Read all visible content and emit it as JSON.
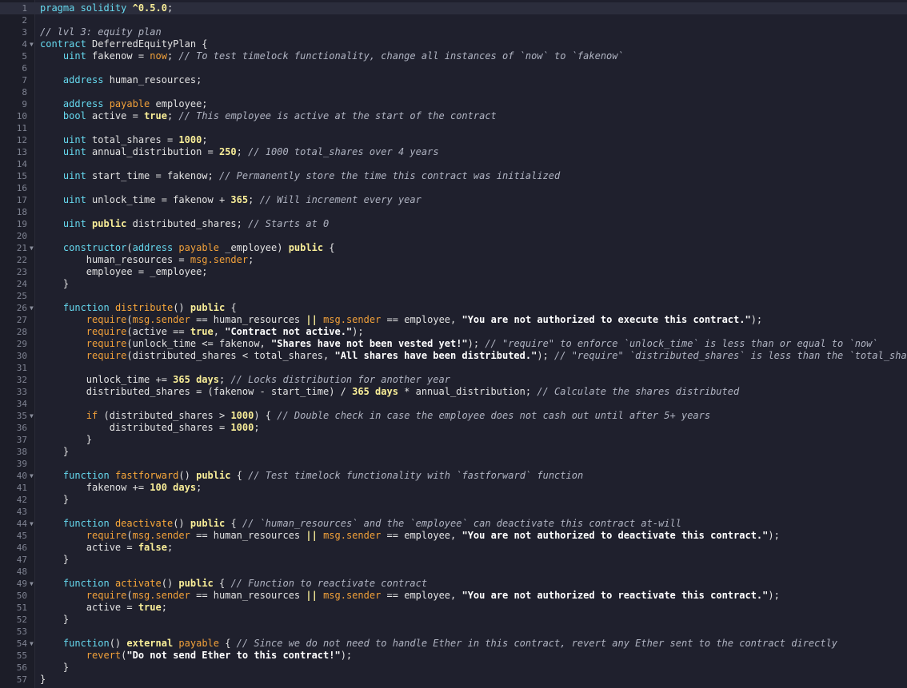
{
  "editor": {
    "language": "solidity",
    "theme_colors": {
      "background": "#1f202d",
      "gutter": "#1c1d28",
      "active_line": "#2b2d3c",
      "keyword": "#66d9ef",
      "special": "#f2a13a",
      "literal": "#f9ee98",
      "comment": "#b0b4c2",
      "string": "#ffffff",
      "text": "#e3e3e3"
    },
    "active_line": 1,
    "fold_lines": [
      4,
      21,
      26,
      35,
      40,
      44,
      49,
      54
    ],
    "lines": [
      [
        [
          "kw",
          "pragma solidity "
        ],
        [
          "lit",
          "^0.5.0"
        ],
        [
          "",
          "; "
        ]
      ],
      [],
      [
        [
          "cm",
          "// lvl 3: equity plan"
        ]
      ],
      [
        [
          "kw",
          "contract "
        ],
        [
          "",
          "DeferredEquityPlan {"
        ]
      ],
      [
        [
          "",
          "    "
        ],
        [
          "kw",
          "uint "
        ],
        [
          "",
          "fakenow = "
        ],
        [
          "sp",
          "now"
        ],
        [
          "",
          "; "
        ],
        [
          "cm",
          "// To test timelock functionality, change all instances of `now` to `fakenow`"
        ]
      ],
      [],
      [
        [
          "",
          "    "
        ],
        [
          "kw",
          "address "
        ],
        [
          "",
          "human_resources;"
        ]
      ],
      [],
      [
        [
          "",
          "    "
        ],
        [
          "kw",
          "address "
        ],
        [
          "sp",
          "payable "
        ],
        [
          "",
          "employee;"
        ]
      ],
      [
        [
          "",
          "    "
        ],
        [
          "kw",
          "bool "
        ],
        [
          "",
          "active = "
        ],
        [
          "lit",
          "true"
        ],
        [
          "",
          "; "
        ],
        [
          "cm",
          "// This employee is active at the start of the contract"
        ]
      ],
      [],
      [
        [
          "",
          "    "
        ],
        [
          "kw",
          "uint "
        ],
        [
          "",
          "total_shares = "
        ],
        [
          "lit",
          "1000"
        ],
        [
          "",
          ";"
        ]
      ],
      [
        [
          "",
          "    "
        ],
        [
          "kw",
          "uint "
        ],
        [
          "",
          "annual_distribution = "
        ],
        [
          "lit",
          "250"
        ],
        [
          "",
          "; "
        ],
        [
          "cm",
          "// 1000 total_shares over 4 years"
        ]
      ],
      [],
      [
        [
          "",
          "    "
        ],
        [
          "kw",
          "uint "
        ],
        [
          "",
          "start_time = fakenow; "
        ],
        [
          "cm",
          "// Permanently store the time this contract was initialized"
        ]
      ],
      [],
      [
        [
          "",
          "    "
        ],
        [
          "kw",
          "uint "
        ],
        [
          "",
          "unlock_time = fakenow + "
        ],
        [
          "lit",
          "365"
        ],
        [
          "",
          "; "
        ],
        [
          "cm",
          "// Will increment every year"
        ]
      ],
      [],
      [
        [
          "",
          "    "
        ],
        [
          "kw",
          "uint "
        ],
        [
          "bf",
          "public "
        ],
        [
          "",
          "distributed_shares; "
        ],
        [
          "cm",
          "// Starts at 0"
        ]
      ],
      [],
      [
        [
          "",
          "    "
        ],
        [
          "kw",
          "constructor"
        ],
        [
          "",
          "("
        ],
        [
          "kw",
          "address "
        ],
        [
          "sp",
          "payable "
        ],
        [
          "",
          "_employee) "
        ],
        [
          "bf",
          "public "
        ],
        [
          "",
          "{"
        ]
      ],
      [
        [
          "",
          "        human_resources = "
        ],
        [
          "sp",
          "msg.sender"
        ],
        [
          "",
          ";"
        ]
      ],
      [
        [
          "",
          "        employee = _employee;"
        ]
      ],
      [
        [
          "",
          "    }"
        ]
      ],
      [],
      [
        [
          "",
          "    "
        ],
        [
          "kw",
          "function "
        ],
        [
          "fn",
          "distribute"
        ],
        [
          "",
          "() "
        ],
        [
          "bf",
          "public "
        ],
        [
          "",
          "{"
        ]
      ],
      [
        [
          "",
          "        "
        ],
        [
          "sp",
          "require"
        ],
        [
          "",
          "("
        ],
        [
          "sp",
          "msg.sender "
        ],
        [
          "",
          "== human_resources "
        ],
        [
          "bf",
          "|| "
        ],
        [
          "sp",
          "msg.sender "
        ],
        [
          "",
          "== employee, "
        ],
        [
          "str",
          "\"You are not authorized to execute this contract.\""
        ],
        [
          "",
          ");"
        ]
      ],
      [
        [
          "",
          "        "
        ],
        [
          "sp",
          "require"
        ],
        [
          "",
          "(active == "
        ],
        [
          "lit",
          "true"
        ],
        [
          "",
          ", "
        ],
        [
          "str",
          "\"Contract not active.\""
        ],
        [
          "",
          ");"
        ]
      ],
      [
        [
          "",
          "        "
        ],
        [
          "sp",
          "require"
        ],
        [
          "",
          "(unlock_time <= fakenow, "
        ],
        [
          "str",
          "\"Shares have not been vested yet!\""
        ],
        [
          "",
          "); "
        ],
        [
          "cm",
          "// \"require\" to enforce `unlock_time` is less than or equal to `now`"
        ]
      ],
      [
        [
          "",
          "        "
        ],
        [
          "sp",
          "require"
        ],
        [
          "",
          "(distributed_shares < total_shares, "
        ],
        [
          "str",
          "\"All shares have been distributed.\""
        ],
        [
          "",
          "); "
        ],
        [
          "cm",
          "// \"require\" `distributed_shares` is less than the `total_shares`"
        ]
      ],
      [],
      [
        [
          "",
          "        unlock_time += "
        ],
        [
          "lit",
          "365 days"
        ],
        [
          "",
          "; "
        ],
        [
          "cm",
          "// Locks distribution for another year"
        ]
      ],
      [
        [
          "",
          "        distributed_shares = (fakenow - start_time) / "
        ],
        [
          "lit",
          "365 days"
        ],
        [
          "",
          " * annual_distribution; "
        ],
        [
          "cm",
          "// Calculate the shares distributed"
        ]
      ],
      [],
      [
        [
          "",
          "        "
        ],
        [
          "sp",
          "if "
        ],
        [
          "",
          "(distributed_shares > "
        ],
        [
          "lit",
          "1000"
        ],
        [
          "",
          ") { "
        ],
        [
          "cm",
          "// Double check in case the employee does not cash out until after 5+ years"
        ]
      ],
      [
        [
          "",
          "            distributed_shares = "
        ],
        [
          "lit",
          "1000"
        ],
        [
          "",
          ";"
        ]
      ],
      [
        [
          "",
          "        }"
        ]
      ],
      [
        [
          "",
          "    }"
        ]
      ],
      [],
      [
        [
          "",
          "    "
        ],
        [
          "kw",
          "function "
        ],
        [
          "fn",
          "fastforward"
        ],
        [
          "",
          "() "
        ],
        [
          "bf",
          "public "
        ],
        [
          "",
          "{ "
        ],
        [
          "cm",
          "// Test timelock functionality with `fastforward` function"
        ]
      ],
      [
        [
          "",
          "        fakenow += "
        ],
        [
          "lit",
          "100 days"
        ],
        [
          "",
          ";"
        ]
      ],
      [
        [
          "",
          "    }"
        ]
      ],
      [],
      [
        [
          "",
          "    "
        ],
        [
          "kw",
          "function "
        ],
        [
          "fn",
          "deactivate"
        ],
        [
          "",
          "() "
        ],
        [
          "bf",
          "public "
        ],
        [
          "",
          "{ "
        ],
        [
          "cm",
          "// `human_resources` and the `employee` can deactivate this contract at-will"
        ]
      ],
      [
        [
          "",
          "        "
        ],
        [
          "sp",
          "require"
        ],
        [
          "",
          "("
        ],
        [
          "sp",
          "msg.sender "
        ],
        [
          "",
          "== human_resources "
        ],
        [
          "bf",
          "|| "
        ],
        [
          "sp",
          "msg.sender "
        ],
        [
          "",
          "== employee, "
        ],
        [
          "str",
          "\"You are not authorized to deactivate this contract.\""
        ],
        [
          "",
          ");"
        ]
      ],
      [
        [
          "",
          "        active = "
        ],
        [
          "lit",
          "false"
        ],
        [
          "",
          ";"
        ]
      ],
      [
        [
          "",
          "    }"
        ]
      ],
      [],
      [
        [
          "",
          "    "
        ],
        [
          "kw",
          "function "
        ],
        [
          "fn",
          "activate"
        ],
        [
          "",
          "() "
        ],
        [
          "bf",
          "public "
        ],
        [
          "",
          "{ "
        ],
        [
          "cm",
          "// Function to reactivate contract"
        ]
      ],
      [
        [
          "",
          "        "
        ],
        [
          "sp",
          "require"
        ],
        [
          "",
          "("
        ],
        [
          "sp",
          "msg.sender "
        ],
        [
          "",
          "== human_resources "
        ],
        [
          "bf",
          "|| "
        ],
        [
          "sp",
          "msg.sender "
        ],
        [
          "",
          "== employee, "
        ],
        [
          "str",
          "\"You are not authorized to reactivate this contract.\""
        ],
        [
          "",
          ");"
        ]
      ],
      [
        [
          "",
          "        active = "
        ],
        [
          "lit",
          "true"
        ],
        [
          "",
          ";"
        ]
      ],
      [
        [
          "",
          "    }"
        ]
      ],
      [],
      [
        [
          "",
          "    "
        ],
        [
          "kw",
          "function"
        ],
        [
          "",
          "() "
        ],
        [
          "bf",
          "external "
        ],
        [
          "sp",
          "payable "
        ],
        [
          "",
          "{ "
        ],
        [
          "cm",
          "// Since we do not need to handle Ether in this contract, revert any Ether sent to the contract directly"
        ]
      ],
      [
        [
          "",
          "        "
        ],
        [
          "sp",
          "revert"
        ],
        [
          "",
          "("
        ],
        [
          "str",
          "\"Do not send Ether to this contract!\""
        ],
        [
          "",
          ");"
        ]
      ],
      [
        [
          "",
          "    }"
        ]
      ],
      [
        [
          "",
          "}"
        ]
      ]
    ]
  }
}
